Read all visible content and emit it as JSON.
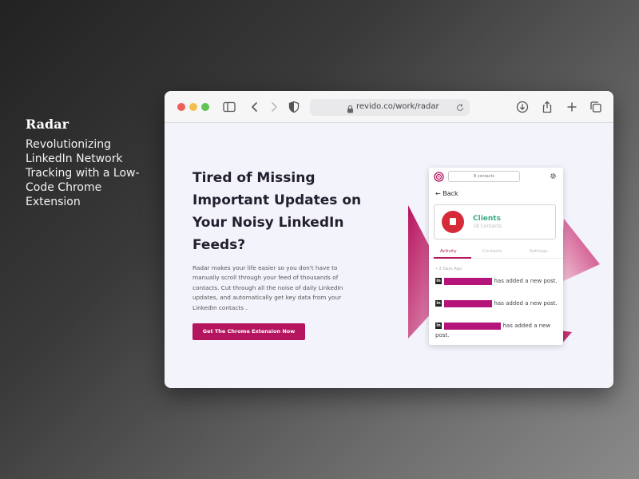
{
  "side": {
    "title": "Radar",
    "description": "Revolutionizing LinkedIn Network Tracking with a Low-Code Chrome Extension"
  },
  "browser": {
    "url": "revido.co/work/radar",
    "toolbar_icons": [
      "sidebar-icon",
      "back-icon",
      "forward-icon",
      "shield-icon",
      "download-icon",
      "share-icon",
      "new-tab-icon",
      "tabs-icon"
    ]
  },
  "hero": {
    "headline_lines": [
      "Tired of Missing",
      "Important Updates on",
      "Your Noisy LinkedIn",
      "Feeds?"
    ],
    "body": "Radar makes your life easier so you don't have to manually scroll through your feed of thousands of contacts. Cut through all the noise of daily LinkedIn updates, and automatically get key data from your LinkedIn contacts .",
    "cta_label": "Get The Chrome Extension Now"
  },
  "extension": {
    "pill_label": "8 contacts",
    "back_label": "Back",
    "client_name": "Clients",
    "client_sub": "18 Contacts",
    "tabs": [
      "Activity",
      "Contacts",
      "Settings"
    ],
    "date_label": "• 2 Days Ago",
    "feed": [
      {
        "badge": "in",
        "text": "has added a new post."
      },
      {
        "badge": "in",
        "text": "has added a new post."
      },
      {
        "badge": "in",
        "text": "has added a new post."
      }
    ]
  },
  "colors": {
    "accent": "#b5145e",
    "client_green": "#3aaa87",
    "avatar_red": "#d62a38"
  }
}
